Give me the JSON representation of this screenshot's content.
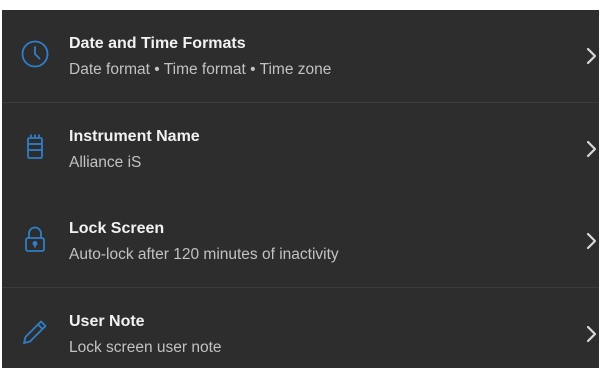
{
  "colors": {
    "background": "#2d2d2d",
    "accent": "#2f7fc8",
    "title_text": "#f2f2f2",
    "subtitle_text": "#c2c2c2",
    "divider": "#3c3c3c"
  },
  "settings": {
    "items": [
      {
        "title": "Date and Time Formats",
        "subtitle": "Date format • Time format • Time zone",
        "icon": "clock-icon"
      },
      {
        "title": "Instrument Name",
        "subtitle": "Alliance iS",
        "icon": "instrument-icon"
      },
      {
        "title": "Lock Screen",
        "subtitle": "Auto-lock after 120 minutes of inactivity",
        "icon": "lock-icon"
      },
      {
        "title": "User Note",
        "subtitle": "Lock screen user note",
        "icon": "pencil-icon"
      }
    ]
  }
}
